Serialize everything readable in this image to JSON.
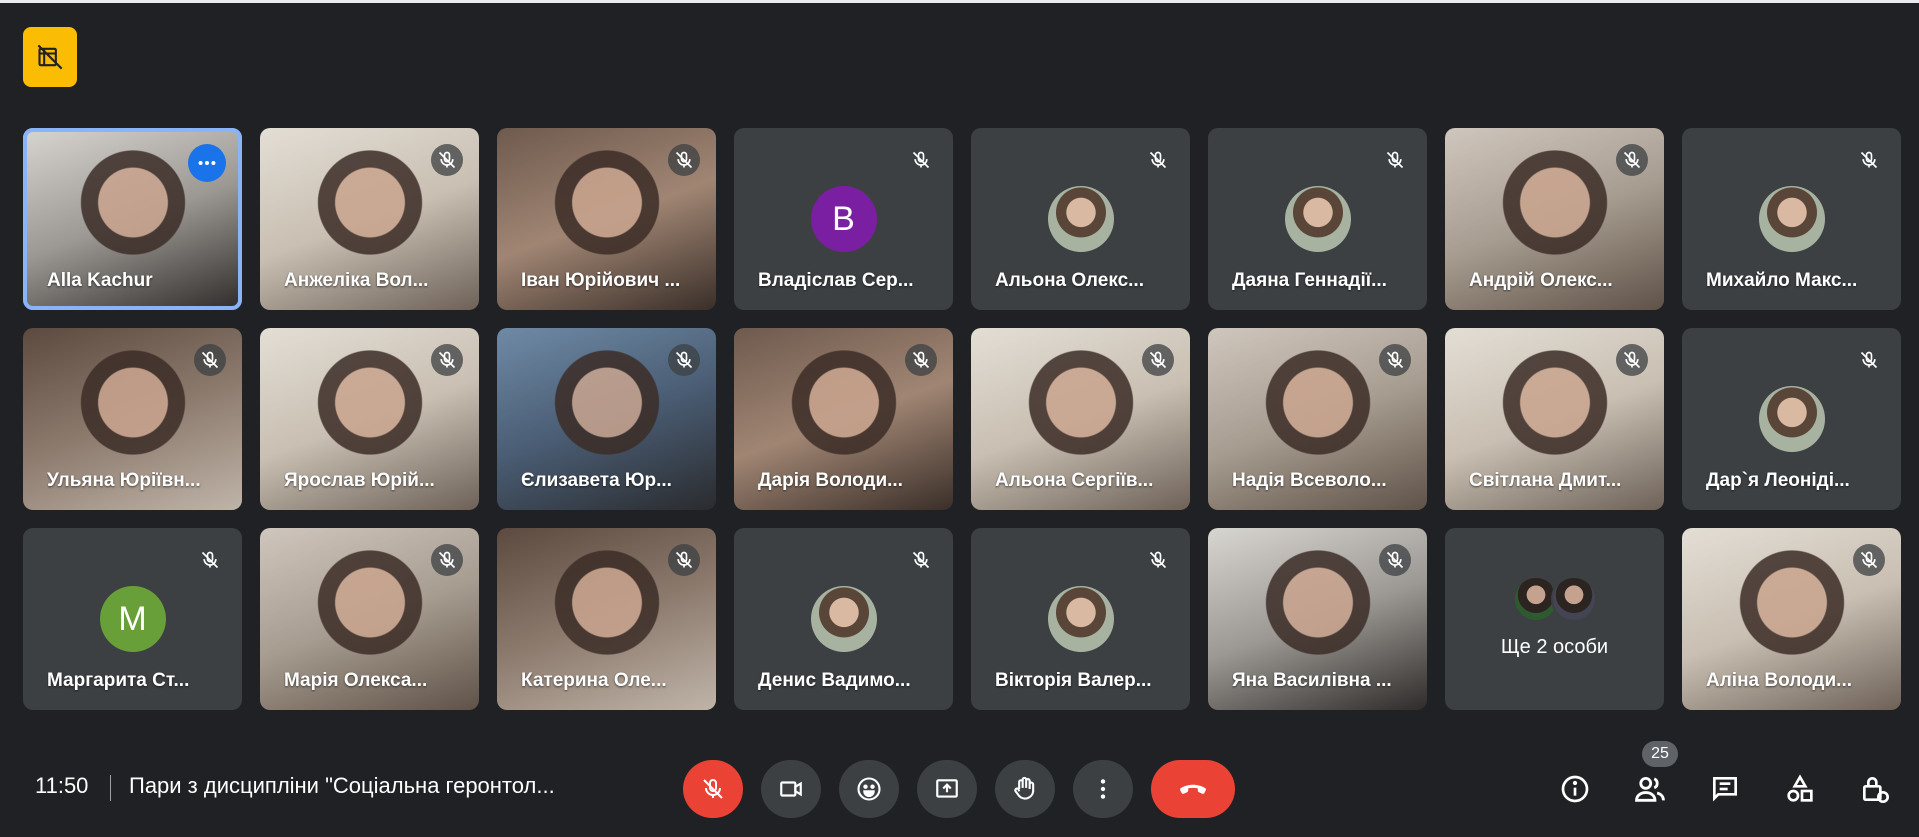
{
  "participants": [
    {
      "name": "Alla Kachur",
      "type": "video",
      "style": "v1",
      "active": true,
      "muted": false
    },
    {
      "name": "Анжеліка Вол...",
      "type": "video",
      "style": "v5",
      "muted": true
    },
    {
      "name": "Іван Юрійович ...",
      "type": "video",
      "style": "v2",
      "muted": true
    },
    {
      "name": "Владіслав Сер...",
      "type": "avatar",
      "initial": "В",
      "color": "#7b1fa2",
      "muted": true
    },
    {
      "name": "Альона Олекс...",
      "type": "photo",
      "muted": true
    },
    {
      "name": "Даяна Геннадії...",
      "type": "photo",
      "muted": true
    },
    {
      "name": "Андрій Олекс...",
      "type": "video",
      "style": "v3",
      "muted": true
    },
    {
      "name": "Михайло Макс...",
      "type": "photo",
      "muted": true
    },
    {
      "name": "Ульяна Юріївн...",
      "type": "video",
      "style": "v6",
      "muted": true
    },
    {
      "name": "Ярослав Юрій...",
      "type": "video",
      "style": "v5",
      "muted": true
    },
    {
      "name": "Єлизавета Юр...",
      "type": "video",
      "style": "v4",
      "muted": true
    },
    {
      "name": "Дарія Володи...",
      "type": "video",
      "style": "v2",
      "muted": true
    },
    {
      "name": "Альона Сергіїв...",
      "type": "video",
      "style": "v5",
      "muted": true
    },
    {
      "name": "Надія Всеволо...",
      "type": "video",
      "style": "v3",
      "muted": true
    },
    {
      "name": "Світлана Дмит...",
      "type": "video",
      "style": "v5",
      "muted": true
    },
    {
      "name": "Дар`я Леоніді...",
      "type": "photo",
      "muted": true
    },
    {
      "name": "Маргарита Ст...",
      "type": "avatar",
      "initial": "M",
      "color": "#689f38",
      "muted": true
    },
    {
      "name": "Марія Олекса...",
      "type": "video",
      "style": "v3",
      "muted": true
    },
    {
      "name": "Катерина Оле...",
      "type": "video",
      "style": "v6",
      "muted": true
    },
    {
      "name": "Денис Вадимо...",
      "type": "photo",
      "muted": true
    },
    {
      "name": "Вікторія Валер...",
      "type": "photo",
      "muted": true
    },
    {
      "name": "Яна Василівна ...",
      "type": "video",
      "style": "v1",
      "muted": true
    },
    {
      "type": "more",
      "label": "Ще 2 особи"
    },
    {
      "name": "Аліна Володи...",
      "type": "video",
      "style": "v5",
      "muted": true
    }
  ],
  "bottom_bar": {
    "time": "11:50",
    "meeting_title": "Пари з дисципліни \"Соціальна геронтол...",
    "participants_count": "25"
  },
  "icons": {
    "record": "recording-off-icon",
    "mic": "mic-off-icon",
    "camera": "camera-icon",
    "emoji": "emoji-icon",
    "present": "present-screen-icon",
    "hand": "raise-hand-icon",
    "more": "more-options-icon",
    "end": "end-call-icon",
    "info": "info-icon",
    "people": "people-icon",
    "chat": "chat-icon",
    "activities": "activities-icon",
    "host": "host-controls-icon"
  },
  "colors": {
    "end_call": "#ea4335",
    "active_speaker": "#8ab4f8",
    "record_badge": "#fbbc04"
  }
}
